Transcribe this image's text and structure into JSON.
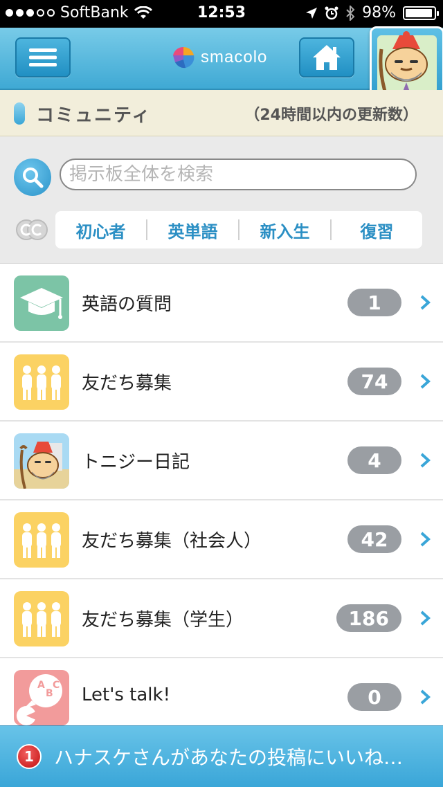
{
  "status": {
    "carrier": "SoftBank",
    "time": "12:53",
    "battery": "98%",
    "signal_dots_filled": 3,
    "signal_dots_total": 5
  },
  "nav": {
    "logo_text": "smacolo",
    "icons": {
      "menu": "hamburger-icon",
      "home": "home-icon",
      "avatar": "tonijii-avatar"
    }
  },
  "community": {
    "title": "コミュニティ",
    "note": "（24時間以内の更新数）"
  },
  "search": {
    "placeholder": "掲示板全体を検索",
    "value": ""
  },
  "tags": [
    "初心者",
    "英単語",
    "新入生",
    "復習"
  ],
  "rows": [
    {
      "label": "英語の質問",
      "count": "1",
      "icon": "graduation-cap-icon",
      "color": "#7cc4a6"
    },
    {
      "label": "友だち募集",
      "count": "74",
      "icon": "people-icon",
      "color": "#fbd263"
    },
    {
      "label": "トニジー日記",
      "count": "4",
      "icon": "tonijii-icon",
      "color": "#9fd3f0"
    },
    {
      "label": "友だち募集（社会人）",
      "count": "42",
      "icon": "people-icon",
      "color": "#fbd263"
    },
    {
      "label": "友だち募集（学生）",
      "count": "186",
      "icon": "people-icon",
      "color": "#fbd263"
    },
    {
      "label": "Let's talk!",
      "count": "0",
      "icon": "abc-speech-icon",
      "color": "#f29b9b"
    }
  ],
  "notification": {
    "badge": "1",
    "text": "ハナスケさんがあなたの投稿にいいね…"
  },
  "colors": {
    "accent": "#2b8fc4",
    "count_badge": "#9a9ea3",
    "nav": "#3fa9d4"
  }
}
